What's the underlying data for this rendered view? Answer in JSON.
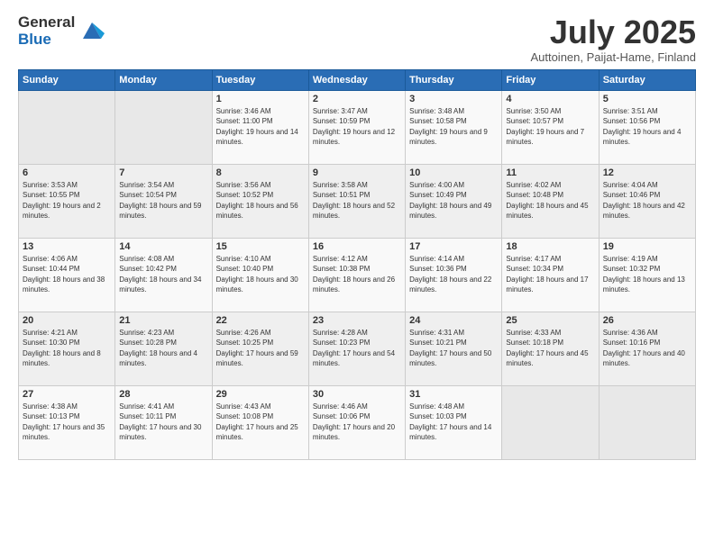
{
  "logo": {
    "general": "General",
    "blue": "Blue"
  },
  "header": {
    "title": "July 2025",
    "subtitle": "Auttoinen, Paijat-Hame, Finland"
  },
  "weekdays": [
    "Sunday",
    "Monday",
    "Tuesday",
    "Wednesday",
    "Thursday",
    "Friday",
    "Saturday"
  ],
  "weeks": [
    [
      {
        "day": "",
        "sunrise": "",
        "sunset": "",
        "daylight": ""
      },
      {
        "day": "",
        "sunrise": "",
        "sunset": "",
        "daylight": ""
      },
      {
        "day": "1",
        "sunrise": "Sunrise: 3:46 AM",
        "sunset": "Sunset: 11:00 PM",
        "daylight": "Daylight: 19 hours and 14 minutes."
      },
      {
        "day": "2",
        "sunrise": "Sunrise: 3:47 AM",
        "sunset": "Sunset: 10:59 PM",
        "daylight": "Daylight: 19 hours and 12 minutes."
      },
      {
        "day": "3",
        "sunrise": "Sunrise: 3:48 AM",
        "sunset": "Sunset: 10:58 PM",
        "daylight": "Daylight: 19 hours and 9 minutes."
      },
      {
        "day": "4",
        "sunrise": "Sunrise: 3:50 AM",
        "sunset": "Sunset: 10:57 PM",
        "daylight": "Daylight: 19 hours and 7 minutes."
      },
      {
        "day": "5",
        "sunrise": "Sunrise: 3:51 AM",
        "sunset": "Sunset: 10:56 PM",
        "daylight": "Daylight: 19 hours and 4 minutes."
      }
    ],
    [
      {
        "day": "6",
        "sunrise": "Sunrise: 3:53 AM",
        "sunset": "Sunset: 10:55 PM",
        "daylight": "Daylight: 19 hours and 2 minutes."
      },
      {
        "day": "7",
        "sunrise": "Sunrise: 3:54 AM",
        "sunset": "Sunset: 10:54 PM",
        "daylight": "Daylight: 18 hours and 59 minutes."
      },
      {
        "day": "8",
        "sunrise": "Sunrise: 3:56 AM",
        "sunset": "Sunset: 10:52 PM",
        "daylight": "Daylight: 18 hours and 56 minutes."
      },
      {
        "day": "9",
        "sunrise": "Sunrise: 3:58 AM",
        "sunset": "Sunset: 10:51 PM",
        "daylight": "Daylight: 18 hours and 52 minutes."
      },
      {
        "day": "10",
        "sunrise": "Sunrise: 4:00 AM",
        "sunset": "Sunset: 10:49 PM",
        "daylight": "Daylight: 18 hours and 49 minutes."
      },
      {
        "day": "11",
        "sunrise": "Sunrise: 4:02 AM",
        "sunset": "Sunset: 10:48 PM",
        "daylight": "Daylight: 18 hours and 45 minutes."
      },
      {
        "day": "12",
        "sunrise": "Sunrise: 4:04 AM",
        "sunset": "Sunset: 10:46 PM",
        "daylight": "Daylight: 18 hours and 42 minutes."
      }
    ],
    [
      {
        "day": "13",
        "sunrise": "Sunrise: 4:06 AM",
        "sunset": "Sunset: 10:44 PM",
        "daylight": "Daylight: 18 hours and 38 minutes."
      },
      {
        "day": "14",
        "sunrise": "Sunrise: 4:08 AM",
        "sunset": "Sunset: 10:42 PM",
        "daylight": "Daylight: 18 hours and 34 minutes."
      },
      {
        "day": "15",
        "sunrise": "Sunrise: 4:10 AM",
        "sunset": "Sunset: 10:40 PM",
        "daylight": "Daylight: 18 hours and 30 minutes."
      },
      {
        "day": "16",
        "sunrise": "Sunrise: 4:12 AM",
        "sunset": "Sunset: 10:38 PM",
        "daylight": "Daylight: 18 hours and 26 minutes."
      },
      {
        "day": "17",
        "sunrise": "Sunrise: 4:14 AM",
        "sunset": "Sunset: 10:36 PM",
        "daylight": "Daylight: 18 hours and 22 minutes."
      },
      {
        "day": "18",
        "sunrise": "Sunrise: 4:17 AM",
        "sunset": "Sunset: 10:34 PM",
        "daylight": "Daylight: 18 hours and 17 minutes."
      },
      {
        "day": "19",
        "sunrise": "Sunrise: 4:19 AM",
        "sunset": "Sunset: 10:32 PM",
        "daylight": "Daylight: 18 hours and 13 minutes."
      }
    ],
    [
      {
        "day": "20",
        "sunrise": "Sunrise: 4:21 AM",
        "sunset": "Sunset: 10:30 PM",
        "daylight": "Daylight: 18 hours and 8 minutes."
      },
      {
        "day": "21",
        "sunrise": "Sunrise: 4:23 AM",
        "sunset": "Sunset: 10:28 PM",
        "daylight": "Daylight: 18 hours and 4 minutes."
      },
      {
        "day": "22",
        "sunrise": "Sunrise: 4:26 AM",
        "sunset": "Sunset: 10:25 PM",
        "daylight": "Daylight: 17 hours and 59 minutes."
      },
      {
        "day": "23",
        "sunrise": "Sunrise: 4:28 AM",
        "sunset": "Sunset: 10:23 PM",
        "daylight": "Daylight: 17 hours and 54 minutes."
      },
      {
        "day": "24",
        "sunrise": "Sunrise: 4:31 AM",
        "sunset": "Sunset: 10:21 PM",
        "daylight": "Daylight: 17 hours and 50 minutes."
      },
      {
        "day": "25",
        "sunrise": "Sunrise: 4:33 AM",
        "sunset": "Sunset: 10:18 PM",
        "daylight": "Daylight: 17 hours and 45 minutes."
      },
      {
        "day": "26",
        "sunrise": "Sunrise: 4:36 AM",
        "sunset": "Sunset: 10:16 PM",
        "daylight": "Daylight: 17 hours and 40 minutes."
      }
    ],
    [
      {
        "day": "27",
        "sunrise": "Sunrise: 4:38 AM",
        "sunset": "Sunset: 10:13 PM",
        "daylight": "Daylight: 17 hours and 35 minutes."
      },
      {
        "day": "28",
        "sunrise": "Sunrise: 4:41 AM",
        "sunset": "Sunset: 10:11 PM",
        "daylight": "Daylight: 17 hours and 30 minutes."
      },
      {
        "day": "29",
        "sunrise": "Sunrise: 4:43 AM",
        "sunset": "Sunset: 10:08 PM",
        "daylight": "Daylight: 17 hours and 25 minutes."
      },
      {
        "day": "30",
        "sunrise": "Sunrise: 4:46 AM",
        "sunset": "Sunset: 10:06 PM",
        "daylight": "Daylight: 17 hours and 20 minutes."
      },
      {
        "day": "31",
        "sunrise": "Sunrise: 4:48 AM",
        "sunset": "Sunset: 10:03 PM",
        "daylight": "Daylight: 17 hours and 14 minutes."
      },
      {
        "day": "",
        "sunrise": "",
        "sunset": "",
        "daylight": ""
      },
      {
        "day": "",
        "sunrise": "",
        "sunset": "",
        "daylight": ""
      }
    ]
  ]
}
